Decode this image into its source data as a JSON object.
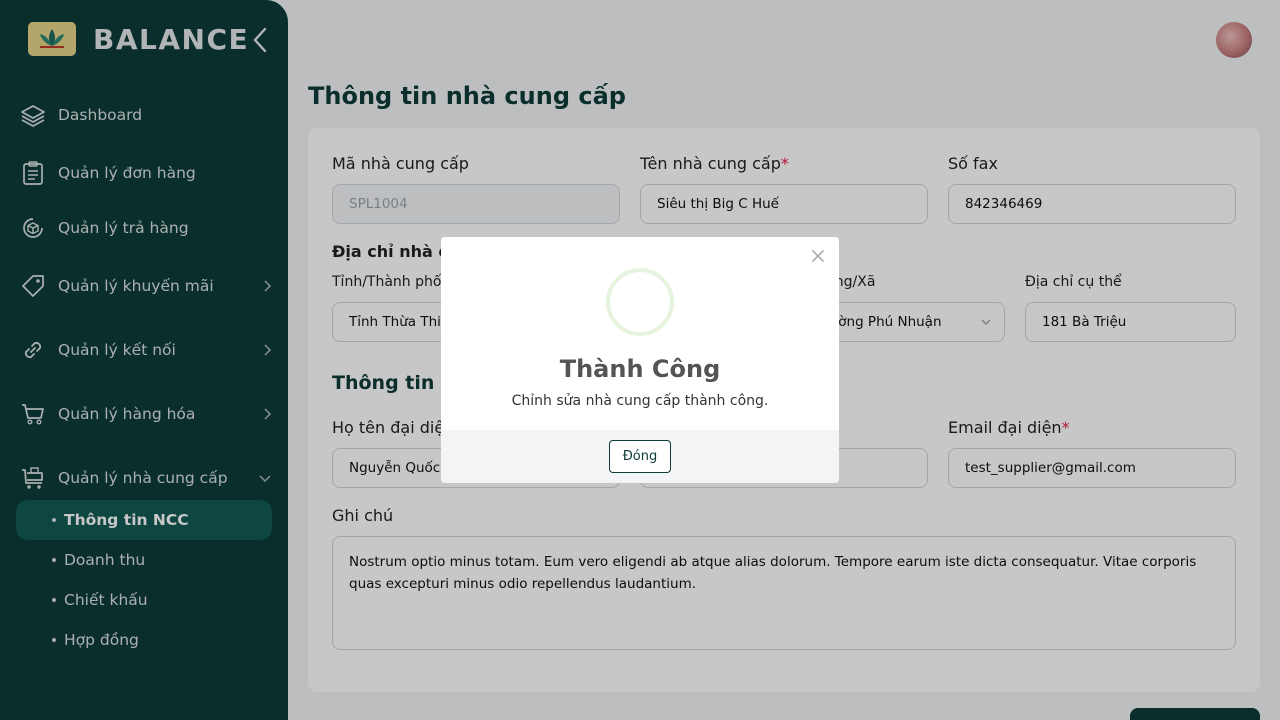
{
  "brand": {
    "name": "BALANCE",
    "logo_icon": "lotus-logo-icon"
  },
  "sidebar": {
    "items": [
      {
        "label": "Dashboard",
        "icon": "layers-icon"
      },
      {
        "label": "Quản lý đơn hàng",
        "icon": "clipboard-icon"
      },
      {
        "label": "Quản lý trả hàng",
        "icon": "return-box-icon"
      },
      {
        "label": "Quản lý khuyến mãi",
        "icon": "tag-icon"
      },
      {
        "label": "Quản lý kết nối",
        "icon": "link-icon"
      },
      {
        "label": "Quản lý hàng hóa",
        "icon": "cart-icon"
      },
      {
        "label": "Quản lý nhà cung cấp",
        "icon": "supplier-cart-icon"
      }
    ],
    "sub_items": [
      {
        "label": "Thông tin NCC",
        "active": true
      },
      {
        "label": "Doanh thu",
        "active": false
      },
      {
        "label": "Chiết khấu",
        "active": false
      },
      {
        "label": "Hợp đồng",
        "active": false
      }
    ]
  },
  "page": {
    "title": "Thông tin nhà cung cấp"
  },
  "form": {
    "code_label": "Mã nhà cung cấp",
    "code_value": "SPL1004",
    "name_label": "Tên nhà cung cấp",
    "name_value": "Siêu thị Big C Huế",
    "fax_label": "Số fax",
    "fax_value": "842346469",
    "address_section": "Địa chỉ nhà cung cấp",
    "province_label": "Tỉnh/Thành phố",
    "province_value": "Tỉnh Thừa Thiên Huế",
    "ward_label": "Phường/Xã",
    "ward_value": "Phường Phú Nhuận",
    "street_label": "Địa chỉ cụ thể",
    "street_value": "181 Bà Triệu",
    "rep_section": "Thông tin người đại diện",
    "rep_name_label": "Họ tên đại diện",
    "rep_name_value": "Nguyễn Quốc",
    "rep_email_label": "Email đại diện",
    "rep_email_value": "test_supplier@gmail.com",
    "note_label": "Ghi chú",
    "note_value": "Nostrum optio minus totam. Eum vero eligendi ab atque alias dolorum. Tempore earum iste dicta consequatur. Vitae corporis quas excepturi minus odio repellendus laudantium.",
    "required_mark": "*"
  },
  "modal": {
    "title": "Thành Công",
    "message": "Chỉnh sửa nhà cung cấp thành công.",
    "button": "Đóng",
    "close_symbol": "×"
  },
  "colors": {
    "primary": "#0e3b39",
    "active_item": "#135a55",
    "required": "#e11d48",
    "success_ring": "#e6f3df"
  }
}
